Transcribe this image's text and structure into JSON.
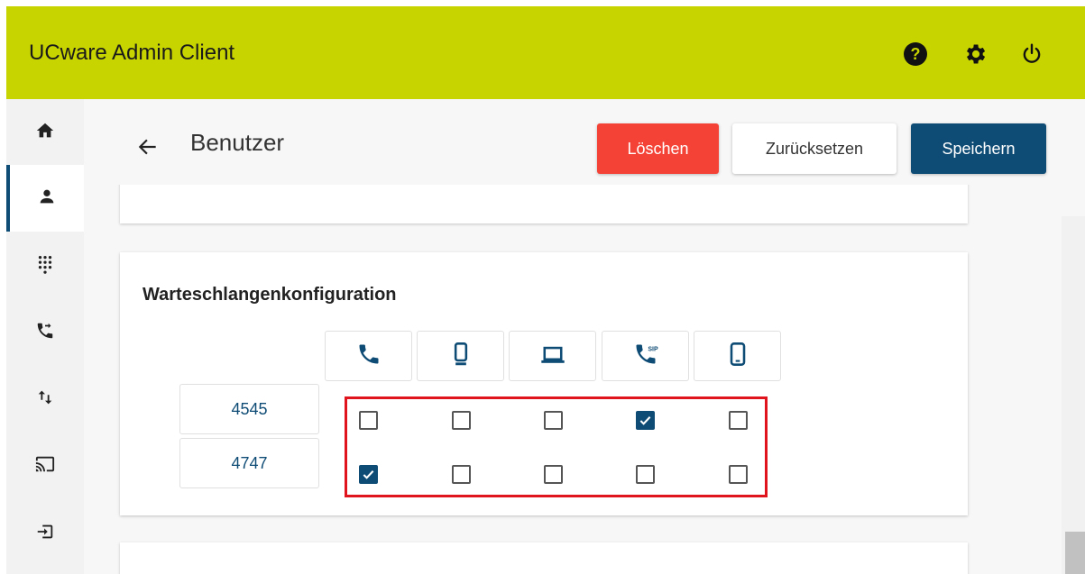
{
  "app": {
    "title": "UCware Admin Client",
    "brand_color": "#c8d400",
    "header_icons": [
      "help-icon",
      "settings-icon",
      "power-icon"
    ]
  },
  "sidebar": {
    "items": [
      {
        "icon": "home-icon",
        "active": false
      },
      {
        "icon": "user-icon",
        "active": true
      },
      {
        "icon": "dialpad-icon",
        "active": false
      },
      {
        "icon": "call-forward-icon",
        "active": false
      },
      {
        "icon": "transfer-icon",
        "active": false
      },
      {
        "icon": "cast-icon",
        "active": false
      },
      {
        "icon": "login-icon",
        "active": false
      }
    ]
  },
  "page": {
    "title": "Benutzer"
  },
  "buttons": {
    "delete": "Löschen",
    "reset": "Zurücksetzen",
    "save": "Speichern",
    "colors": {
      "delete": "#f44336",
      "save": "#0f4c75"
    }
  },
  "queue_config": {
    "title": "Warteschlangenkonfiguration",
    "devices": [
      "phone-icon",
      "desk-phone-icon",
      "laptop-icon",
      "sip-phone-icon",
      "mobile-icon"
    ],
    "rows": [
      {
        "number": "4545",
        "checked": [
          false,
          false,
          false,
          true,
          false
        ]
      },
      {
        "number": "4747",
        "checked": [
          true,
          false,
          false,
          false,
          false
        ]
      }
    ]
  }
}
